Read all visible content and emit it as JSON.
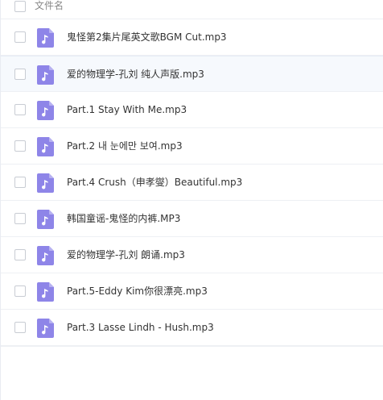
{
  "header": {
    "column_label": "文件名"
  },
  "colors": {
    "accent": "#8e85e8",
    "text": "#333333",
    "muted": "#888888"
  },
  "files": [
    {
      "name": "鬼怪第2集片尾英文歌BGM Cut.mp3",
      "icon": "audio-file-icon"
    },
    {
      "name": "爱的物理学-孔刘 纯人声版.mp3",
      "icon": "audio-file-icon"
    },
    {
      "name": "Part.1 Stay With Me.mp3",
      "icon": "audio-file-icon"
    },
    {
      "name": "Part.2 내 눈에만 보여.mp3",
      "icon": "audio-file-icon"
    },
    {
      "name": "Part.4 Crush（申孝燮）Beautiful.mp3",
      "icon": "audio-file-icon"
    },
    {
      "name": "韩国童谣-鬼怪的内裤.MP3",
      "icon": "audio-file-icon"
    },
    {
      "name": "爱的物理学-孔刘 朗诵.mp3",
      "icon": "audio-file-icon"
    },
    {
      "name": "Part.5-Eddy Kim你很漂亮.mp3",
      "icon": "audio-file-icon"
    },
    {
      "name": "Part.3 Lasse Lindh - Hush.mp3",
      "icon": "audio-file-icon"
    }
  ]
}
